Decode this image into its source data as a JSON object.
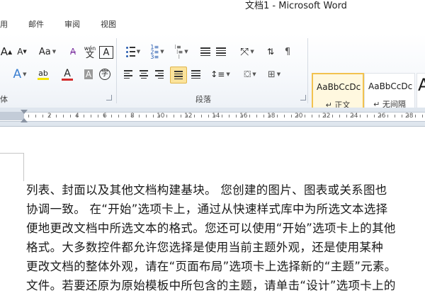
{
  "window": {
    "title": "文档1 - Microsoft Word"
  },
  "tabs": [
    {
      "label": "用"
    },
    {
      "label": "邮件"
    },
    {
      "label": "审阅"
    },
    {
      "label": "视图"
    }
  ],
  "ribbon": {
    "font_group": {
      "label": "体",
      "grow_glyph": "A",
      "shrink_glyph": "A",
      "case_glyph": "Aa",
      "phonetic_glyph": "wén",
      "border_char_glyph": "A",
      "text_effects_glyph": "A",
      "highlight_glyph": "ab",
      "font_color_glyph": "A",
      "shading_glyph": "A",
      "enclose_glyph": "字"
    },
    "paragraph_group": {
      "label": "段落"
    },
    "styles": [
      {
        "sample": "AaBbCcDc",
        "name": "↵ 正文",
        "selected": true
      },
      {
        "sample": "AaBbCcDc",
        "name": "↵ 无间隔",
        "selected": false
      },
      {
        "sample": "A",
        "name": "",
        "selected": false
      }
    ],
    "colors": {
      "highlight": "#f5e400",
      "font_color": "#d42a2a",
      "accent": "#f2c24f"
    }
  },
  "ruler": {
    "numbers": [
      "2",
      "4",
      "6",
      "8",
      "10",
      "12",
      "14",
      "16",
      "18",
      "20",
      "22",
      "24",
      "26",
      "28"
    ]
  },
  "document": {
    "lines": [
      "列表、封面以及其他文档构建基块。 您创建的图片、图表或关系图也",
      "协调一致。 在“开始”选项卡上，通过从快速样式库中为所选文本选择",
      "便地更改文档中所选文本的格式。您还可以使用“开始”选项卡上的其他",
      "格式。大多数控件都允许您选择是使用当前主题外观，还是使用某种",
      "更改文档的整体外观，请在“页面布局”选项卡上选择新的“主题”元素。",
      "文件。若要还原为原始模板中所包含的主题，请单击“设计”选项卡上的"
    ]
  }
}
